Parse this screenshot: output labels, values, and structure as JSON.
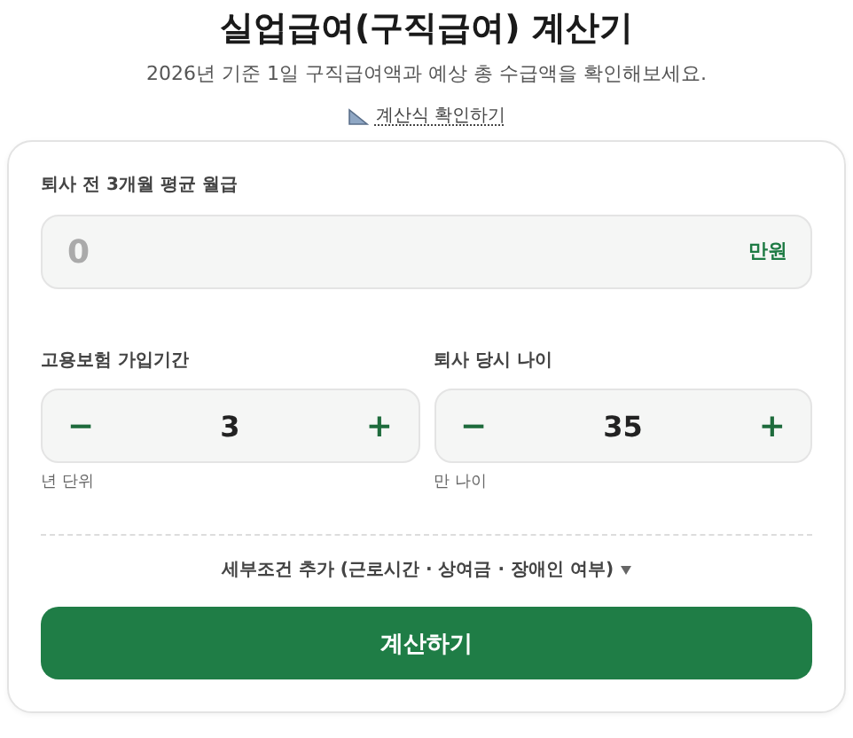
{
  "header": {
    "title": "실업급여(구직급여) 계산기",
    "subtitle": "2026년 기준 1일 구직급여액과 예상 총 수급액을 확인해보세요.",
    "formula_link": "계산식 확인하기"
  },
  "salary": {
    "label": "퇴사 전 3개월 평균 월급",
    "placeholder": "0",
    "unit": "만원"
  },
  "steppers": [
    {
      "label": "고용보험 가입기간",
      "minus": "−",
      "value": "3",
      "plus": "+",
      "hint": "년 단위"
    },
    {
      "label": "퇴사 당시 나이",
      "minus": "−",
      "value": "35",
      "plus": "+",
      "hint": "만 나이"
    }
  ],
  "details_toggle": {
    "label": "세부조건 추가 (근로시간 · 상여금 · 장애인 여부)",
    "expanded": false
  },
  "submit": "계산하기"
}
